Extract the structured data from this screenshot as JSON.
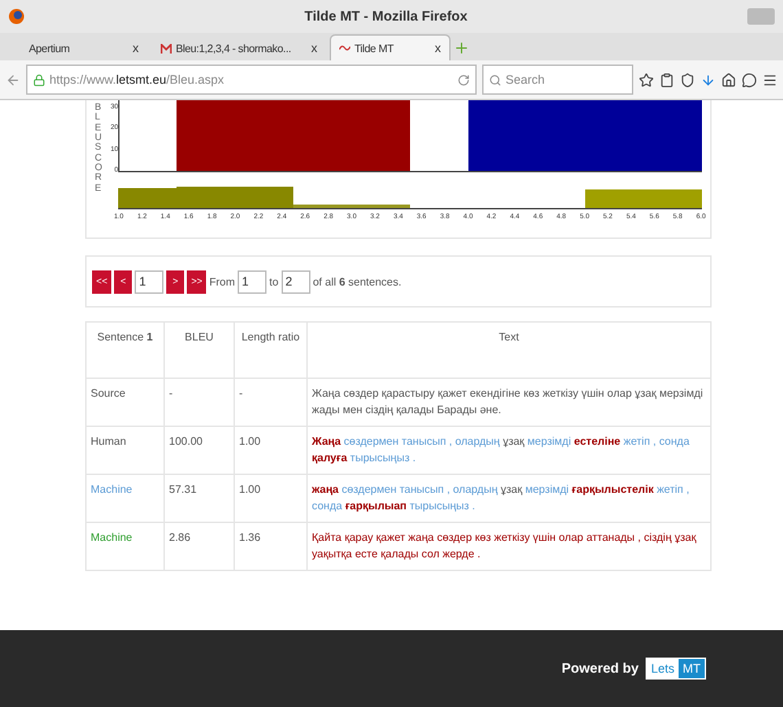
{
  "window": {
    "title": "Tilde MT - Mozilla Firefox"
  },
  "tabs": [
    {
      "label": "Apertium",
      "selected": false,
      "close": "x"
    },
    {
      "label": "Bleu:1,2,3,4 - shormako...",
      "selected": false,
      "close": "x"
    },
    {
      "label": "Tilde MT",
      "selected": true,
      "close": "x"
    }
  ],
  "address": {
    "prefix": "https://www.",
    "domain": "letsmt.eu",
    "path": "/Bleu.aspx"
  },
  "search": {
    "placeholder": "Search"
  },
  "chart": {
    "ylabel": "BLEU SCORE",
    "yticks": [
      "30",
      "20",
      "10",
      "0"
    ],
    "xticks": [
      "1.0",
      "1.2",
      "1.4",
      "1.6",
      "1.8",
      "2.0",
      "2.2",
      "2.4",
      "2.6",
      "2.8",
      "3.0",
      "3.2",
      "3.4",
      "3.6",
      "3.8",
      "4.0",
      "4.2",
      "4.4",
      "4.6",
      "4.8",
      "5.0",
      "5.2",
      "5.4",
      "5.6",
      "5.8",
      "6.0"
    ]
  },
  "pager": {
    "first": "<<",
    "prev": "<",
    "page": "1",
    "next": ">",
    "last": ">>",
    "from_label": "From",
    "from": "1",
    "to_label": "to",
    "to": "2",
    "of_before": "of all ",
    "of_count": "6",
    "of_after": " sentences."
  },
  "table": {
    "columns": [
      {
        "label": "Sentence ",
        "bold": "1"
      },
      {
        "label": "BLEU"
      },
      {
        "label": "Length ratio"
      },
      {
        "label": "Text"
      }
    ],
    "rows": [
      {
        "label": "Source",
        "color": "#555555",
        "bleu": "-",
        "ratio": "-",
        "tokens": [
          {
            "text": "Жаңа сөздер қарастыру қажет екендігіне көз жеткізу үшін олар ұзақ мерзімді жады мен сіздің қалады Барады әне.",
            "color": "#555555",
            "bold": false
          }
        ]
      },
      {
        "label": "Human",
        "color": "#555555",
        "bleu": "100.00",
        "ratio": "1.00",
        "tokens": [
          {
            "text": "Жаңа",
            "color": "#a00000",
            "bold": true
          },
          {
            "text": "сөздермен танысып , олардың",
            "color": "#5b9bd5",
            "bold": false
          },
          {
            "text": "ұзақ",
            "color": "#555555",
            "bold": false
          },
          {
            "text": "мерзімді",
            "color": "#5b9bd5",
            "bold": false
          },
          {
            "text": "естеліне",
            "color": "#a00000",
            "bold": true
          },
          {
            "text": "жетіп , сонда",
            "color": "#5b9bd5",
            "bold": false
          },
          {
            "text": "қалуға",
            "color": "#a00000",
            "bold": true
          },
          {
            "text": "тырысыңыз .",
            "color": "#5b9bd5",
            "bold": false
          }
        ]
      },
      {
        "label": "Machine",
        "color": "#5b9bd5",
        "bleu": "57.31",
        "ratio": "1.00",
        "tokens": [
          {
            "text": "жаңа",
            "color": "#a00000",
            "bold": true
          },
          {
            "text": "сөздермен танысып , олардың",
            "color": "#5b9bd5",
            "bold": false
          },
          {
            "text": "ұзақ",
            "color": "#555555",
            "bold": false
          },
          {
            "text": "мерзімді",
            "color": "#5b9bd5",
            "bold": false
          },
          {
            "text": "ғарқылыстелік",
            "color": "#a00000",
            "bold": true
          },
          {
            "text": "жетіп , сонда",
            "color": "#5b9bd5",
            "bold": false
          },
          {
            "text": "ғарқылыап",
            "color": "#a00000",
            "bold": true
          },
          {
            "text": "тырысыңыз .",
            "color": "#5b9bd5",
            "bold": false
          }
        ]
      },
      {
        "label": "Machine",
        "color": "#2e9e2e",
        "bleu": "2.86",
        "ratio": "1.36",
        "tokens": [
          {
            "text": "Қайта қарау қажет жаңа сөздер көз жеткізу үшін олар аттанады , сіздің ұзақ уақытқа есте қалады сол жерде .",
            "color": "#a00000",
            "bold": false
          }
        ]
      }
    ]
  },
  "footer": {
    "powered": "Powered by",
    "logo_a": "Lets",
    "logo_b": "MT"
  }
}
